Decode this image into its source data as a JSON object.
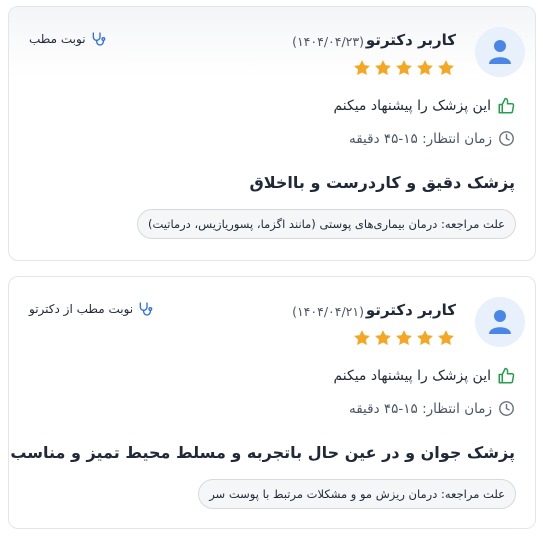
{
  "reviews": [
    {
      "username": "کاربر دکترتو",
      "date": "(۱۴۰۴/۰۴/۲۳)",
      "rating": 5,
      "clinic_label": "نوبت مطب",
      "recommend_text": "این پزشک را پیشنهاد میکنم",
      "wait_time": "زمان انتظار: ۱۵-۴۵ دقیقه",
      "comment": "پزشک دقیق و کاردرست و بااخلاق",
      "reason": "علت مراجعه: درمان بیماری‌های پوستی (مانند اگزما، پسوریازیس، درماتیت)"
    },
    {
      "username": "کاربر دکترتو",
      "date": "(۱۴۰۴/۰۴/۲۱)",
      "rating": 5,
      "clinic_label": "نوبت مطب از دکترتو",
      "recommend_text": "این پزشک را پیشنهاد میکنم",
      "wait_time": "زمان انتظار: ۱۵-۴۵ دقیقه",
      "comment": "پزشک جوان و در عین حال باتجربه و مسلط محیط تمیز و مناسب",
      "reason": "علت مراجعه: درمان ریزش مو و مشکلات مرتبط با پوست سر"
    }
  ],
  "colors": {
    "star": "#f5a623",
    "thumb": "#22a04a",
    "stethoscope": "#2f6fe4",
    "avatar_bg": "#e8f0fc",
    "avatar_fg": "#4a85e8"
  },
  "icons": [
    "user-avatar-icon",
    "star-icon",
    "stethoscope-icon",
    "thumbs-up-icon",
    "clock-icon"
  ]
}
